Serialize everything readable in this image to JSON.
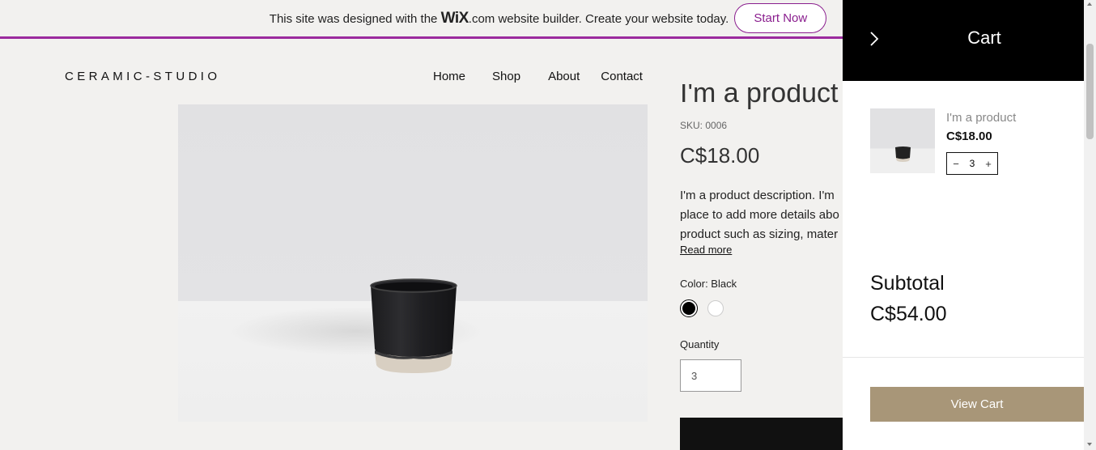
{
  "wix_banner": {
    "text_before": "This site was designed with the ",
    "logo": "WiX",
    "text_after": ".com website builder. Create your website today.",
    "cta": "Start Now"
  },
  "header": {
    "brand": "CERAMIC-STUDIO",
    "nav": [
      "Home",
      "Shop",
      "About",
      "Contact"
    ]
  },
  "product": {
    "title": "I'm a product",
    "sku": "SKU: 0006",
    "price": "C$18.00",
    "description_lines": [
      "I'm a product description. I'm",
      "place to add more details abo",
      "product such as sizing, mater"
    ],
    "read_more": "Read more",
    "color_label": "Color: Black",
    "quantity_label": "Quantity",
    "quantity_value": "3"
  },
  "cart": {
    "title": "Cart",
    "item": {
      "name": "I'm a product",
      "price": "C$18.00",
      "quantity": "3",
      "minus": "−",
      "plus": "+"
    },
    "subtotal_label": "Subtotal",
    "subtotal_value": "C$54.00",
    "view_cart": "View Cart"
  },
  "colors": {
    "accent_purple": "#8a1e8e",
    "view_cart_bg": "#a89678",
    "cart_header_bg": "#000000"
  }
}
